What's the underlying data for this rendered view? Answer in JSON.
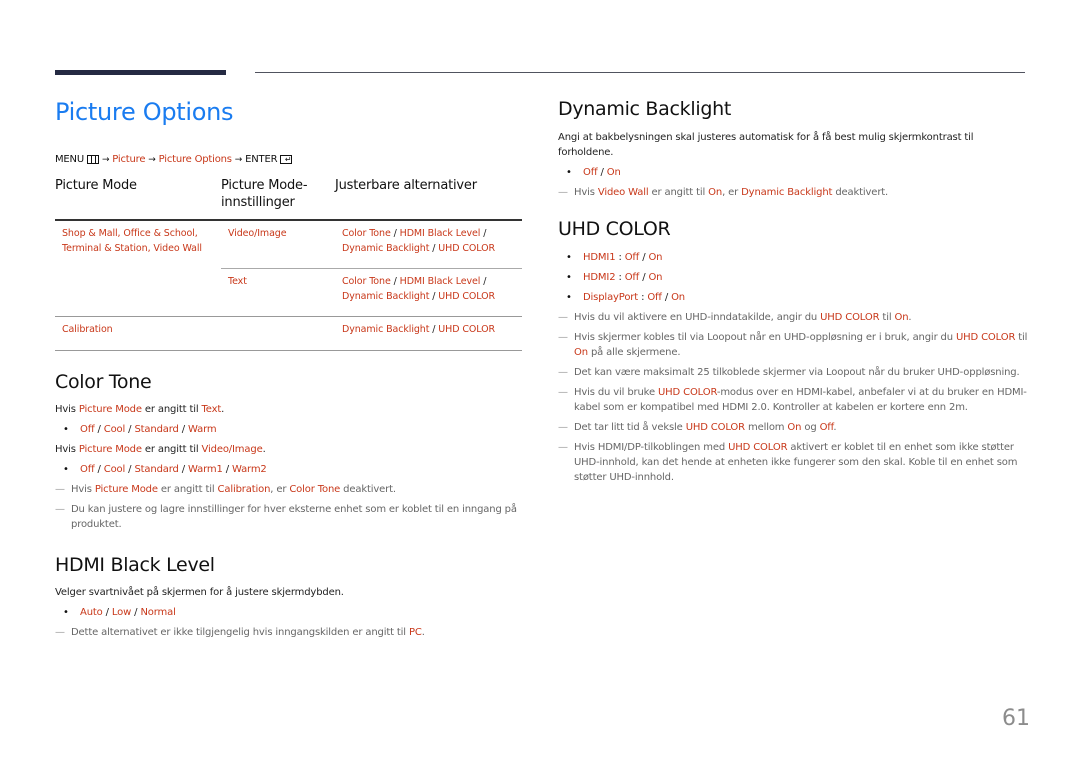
{
  "page_title": "Picture Options",
  "menu_path": {
    "menu": "MENU",
    "menu_icon": "menu-grid-icon",
    "items": [
      "Picture",
      "Picture Options"
    ],
    "enter": "ENTER",
    "enter_icon": "enter-icon",
    "arrow": "→"
  },
  "options_table": {
    "headers": [
      "Picture Mode",
      "Picture Mode-\ninnstillinger",
      "Justerbare alternativer"
    ],
    "rows": [
      {
        "mode": "Shop & Mall, Office & School, Terminal & Station, Video Wall",
        "setting": "Video/Image",
        "options": [
          "Color Tone",
          "HDMI Black Level",
          "Dynamic Backlight",
          "UHD COLOR"
        ]
      },
      {
        "mode": "",
        "setting": "Text",
        "options": [
          "Color Tone",
          "HDMI Black Level",
          "Dynamic Backlight",
          "UHD COLOR"
        ]
      },
      {
        "mode": "Calibration",
        "setting": "",
        "options": [
          "Dynamic Backlight",
          "UHD COLOR"
        ]
      }
    ]
  },
  "color_tone": {
    "title": "Color Tone",
    "cond1": {
      "pre": "Hvis ",
      "hl1": "Picture Mode",
      "mid": " er angitt til ",
      "hl2": "Text",
      "post": "."
    },
    "bullet1": [
      "Off",
      "Cool",
      "Standard",
      "Warm"
    ],
    "cond2": {
      "pre": "Hvis ",
      "hl1": "Picture Mode",
      "mid": " er angitt til ",
      "hl2": "Video/Image",
      "post": "."
    },
    "bullet2": [
      "Off",
      "Cool",
      "Standard",
      "Warm1",
      "Warm2"
    ],
    "note1": {
      "pre": "Hvis ",
      "hl1": "Picture Mode",
      "mid": " er angitt til ",
      "hl2": "Calibration",
      "mid2": ", er ",
      "hl3": "Color Tone",
      "post": " deaktivert."
    },
    "note2": "Du kan justere og lagre innstillinger for hver eksterne enhet som er koblet til en inngang på produktet."
  },
  "hdmi_black_level": {
    "title": "HDMI Black Level",
    "description": "Velger svartnivået på skjermen for å justere skjermdybden.",
    "bullet": [
      "Auto",
      "Low",
      "Normal"
    ],
    "note": {
      "pre": "Dette alternativet er ikke tilgjengelig hvis inngangskilden er angitt til ",
      "hl": "PC",
      "post": "."
    }
  },
  "dynamic_backlight": {
    "title": "Dynamic Backlight",
    "description": "Angi at bakbelysningen skal justeres automatisk for å få best mulig skjermkontrast til forholdene.",
    "bullet": [
      "Off",
      "On"
    ],
    "note": {
      "pre": "Hvis ",
      "hl1": "Video Wall",
      "mid": " er angitt til ",
      "hl2": "On",
      "mid2": ", er ",
      "hl3": "Dynamic Backlight",
      "post": " deaktivert."
    }
  },
  "uhd_color": {
    "title": "UHD COLOR",
    "bullets": [
      {
        "label": "HDMI1",
        "options": [
          "Off",
          "On"
        ]
      },
      {
        "label": "HDMI2",
        "options": [
          "Off",
          "On"
        ]
      },
      {
        "label": "DisplayPort",
        "options": [
          "Off",
          "On"
        ]
      }
    ],
    "notes": {
      "n1": {
        "pre": "Hvis du vil aktivere en UHD-inndatakilde, angir du ",
        "hl1": "UHD COLOR",
        "mid": " til ",
        "hl2": "On",
        "post": "."
      },
      "n2": {
        "pre": "Hvis skjermer kobles til via Loopout når en UHD-oppløsning er i bruk, angir du ",
        "hl1": "UHD COLOR",
        "mid": " til ",
        "hl2": "On",
        "post": " på alle skjermene."
      },
      "n3": "Det kan være maksimalt 25 tilkoblede skjermer via Loopout når du bruker UHD-oppløsning.",
      "n4": {
        "pre": "Hvis du vil bruke ",
        "hl1": "UHD COLOR",
        "post": "-modus over en HDMI-kabel, anbefaler vi at du bruker en HDMI-kabel som er kompatibel med HDMI 2.0. Kontroller at kabelen er kortere enn 2m."
      },
      "n5": {
        "pre": "Det tar litt tid å veksle ",
        "hl1": "UHD COLOR",
        "mid": " mellom ",
        "hl2": "On",
        "mid2": " og ",
        "hl3": "Off",
        "post": "."
      },
      "n6": {
        "pre": "Hvis HDMI/DP-tilkoblingen med ",
        "hl1": "UHD COLOR",
        "post": " aktivert er koblet til en enhet som ikke støtter UHD-innhold, kan det hende at enheten ikke fungerer som den skal. Koble til en enhet som støtter UHD-innhold."
      }
    }
  },
  "symbols": {
    "bullet": "•",
    "dash": "—",
    "slash": " / ",
    "colon": " : "
  },
  "page_number": "61",
  "colors": {
    "title_blue": "#1a7cf0",
    "highlight_red": "#c8381a",
    "header_bar": "#252a43",
    "note_gray": "#666666"
  }
}
